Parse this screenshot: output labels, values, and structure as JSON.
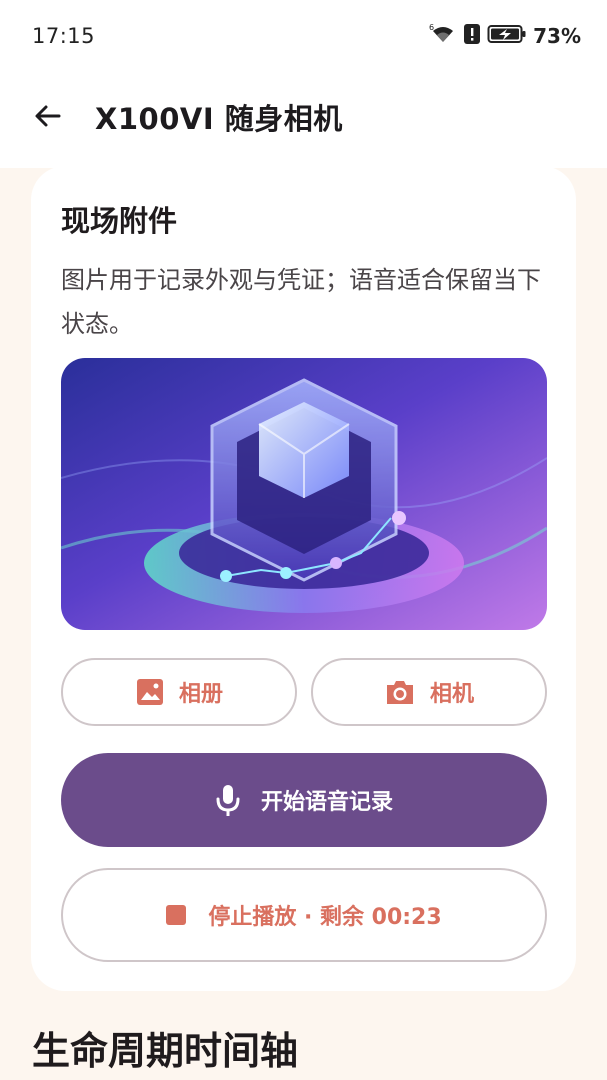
{
  "status_bar": {
    "time": "17:15",
    "battery": "73%",
    "icons": [
      "wifi-icon",
      "alert-icon",
      "battery-charging-icon"
    ]
  },
  "app_bar": {
    "title": "X100VI 随身相机",
    "back_icon": "arrow-left-icon"
  },
  "attachments_card": {
    "title": "现场附件",
    "description": "图片用于记录外观与凭证；语音适合保留当下状态。",
    "album_button": {
      "label": "相册",
      "icon": "image-icon"
    },
    "camera_button": {
      "label": "相机",
      "icon": "camera-icon"
    },
    "record_button": {
      "label": "开始语音记录",
      "icon": "mic-icon"
    },
    "stop_button": {
      "label": "停止播放 · 剩余 00:23",
      "icon": "stop-icon"
    }
  },
  "lifecycle": {
    "title": "生命周期时间轴"
  },
  "colors": {
    "accent": "#d9705f",
    "primary": "#6b4c8b",
    "background": "#fdf6ef",
    "card": "#ffffff"
  }
}
